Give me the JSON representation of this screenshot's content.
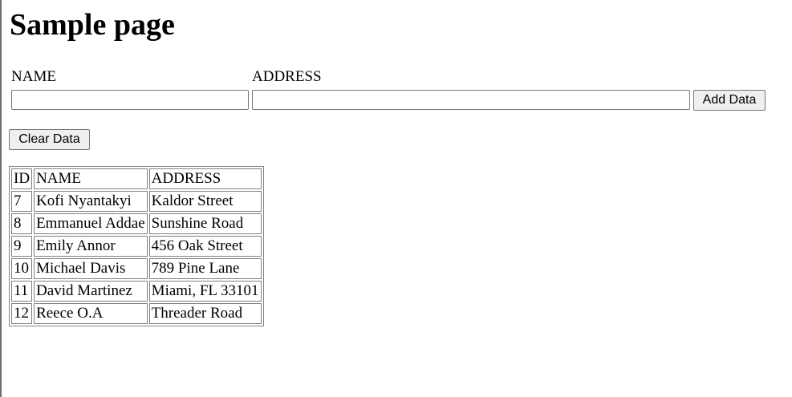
{
  "page": {
    "title": "Sample page"
  },
  "form": {
    "name_label": "NAME",
    "address_label": "ADDRESS",
    "name_value": "",
    "address_value": "",
    "add_button": "Add Data",
    "clear_button": "Clear Data"
  },
  "table": {
    "headers": [
      "ID",
      "NAME",
      "ADDRESS"
    ],
    "rows": [
      [
        "7",
        "Kofi Nyantakyi",
        "Kaldor Street"
      ],
      [
        "8",
        "Emmanuel Addae",
        "Sunshine Road"
      ],
      [
        "9",
        "Emily Annor",
        "456 Oak Street"
      ],
      [
        "10",
        "Michael Davis",
        "789 Pine Lane"
      ],
      [
        "11",
        "David Martinez",
        "Miami, FL 33101"
      ],
      [
        "12",
        "Reece O.A",
        "Threader Road"
      ]
    ]
  }
}
